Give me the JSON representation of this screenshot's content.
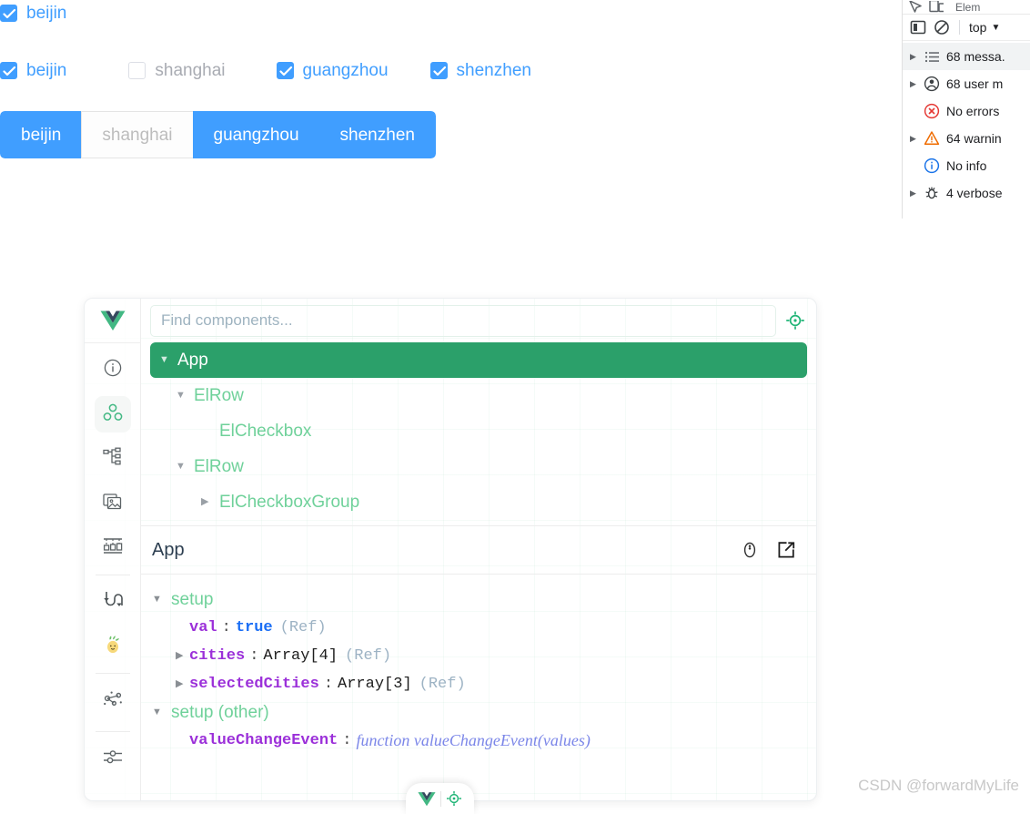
{
  "demo": {
    "check_all": {
      "label": "beijin",
      "checked": true
    },
    "checkbox_group": [
      {
        "label": "beijin",
        "checked": true
      },
      {
        "label": "shanghai",
        "checked": false
      },
      {
        "label": "guangzhou",
        "checked": true
      },
      {
        "label": "shenzhen",
        "checked": true
      }
    ],
    "button_group": [
      {
        "label": "beijin",
        "active": true
      },
      {
        "label": "shanghai",
        "active": false
      },
      {
        "label": "guangzhou",
        "active": true
      },
      {
        "label": "shenzhen",
        "active": true
      }
    ],
    "accent_color": "#409eff",
    "muted_color": "#a8abb2"
  },
  "devtools": {
    "tab_label": "Elem",
    "context": "top",
    "rows": [
      {
        "icon": "list-icon",
        "label": "68 messa.",
        "expandable": true,
        "selected": true
      },
      {
        "icon": "user-icon",
        "label": "68 user m",
        "expandable": true,
        "selected": false
      },
      {
        "icon": "error-icon",
        "label": "No errors",
        "expandable": false,
        "selected": false
      },
      {
        "icon": "warning-icon",
        "label": "64 warnin",
        "expandable": true,
        "selected": false
      },
      {
        "icon": "info-icon",
        "label": "No info",
        "expandable": false,
        "selected": false
      },
      {
        "icon": "verbose-icon",
        "label": "4 verbose",
        "expandable": true,
        "selected": false
      }
    ]
  },
  "vue_devtools": {
    "search": {
      "placeholder": "Find components...",
      "value": ""
    },
    "rail_icons": [
      "info-circle-icon",
      "components-icon",
      "component-tree-icon",
      "assets-icon",
      "timeline-icon",
      "routes-icon",
      "pinia-icon",
      "graph-icon",
      "settings-sliders-icon"
    ],
    "tree": [
      {
        "label": "App",
        "depth": 0,
        "expanded": true,
        "leaf": false,
        "selected": true
      },
      {
        "label": "ElRow",
        "depth": 1,
        "expanded": true,
        "leaf": false,
        "selected": false
      },
      {
        "label": "ElCheckbox",
        "depth": 2,
        "expanded": false,
        "leaf": true,
        "selected": false
      },
      {
        "label": "ElRow",
        "depth": 1,
        "expanded": true,
        "leaf": false,
        "selected": false
      },
      {
        "label": "ElCheckboxGroup",
        "depth": 2,
        "expanded": false,
        "leaf": false,
        "selected": false
      }
    ],
    "detail": {
      "title": "App",
      "actions": [
        "scroll-to-component-icon",
        "open-in-editor-icon"
      ],
      "groups": [
        {
          "name": "setup",
          "expanded": true,
          "entries": [
            {
              "key": "val",
              "sep": ":",
              "value": "true",
              "value_kind": "bool",
              "tag": "(Ref)",
              "expandable": false
            },
            {
              "key": "cities",
              "sep": ":",
              "value": "Array[4]",
              "value_kind": "array",
              "tag": "(Ref)",
              "expandable": true
            },
            {
              "key": "selectedCities",
              "sep": ":",
              "value": "Array[3]",
              "value_kind": "array",
              "tag": "(Ref)",
              "expandable": true
            }
          ]
        },
        {
          "name": "setup (other)",
          "expanded": true,
          "entries": [
            {
              "key": "valueChangeEvent",
              "sep": ":",
              "value": "function valueChangeEvent(values)",
              "value_kind": "function",
              "tag": "",
              "expandable": false
            }
          ]
        }
      ]
    },
    "pill_buttons": [
      "vue-logo-icon",
      "inspect-target-icon"
    ],
    "accent_color": "#42b883",
    "tree_selected_bg": "#2ba06a"
  },
  "watermark": "CSDN @forwardMyLife"
}
